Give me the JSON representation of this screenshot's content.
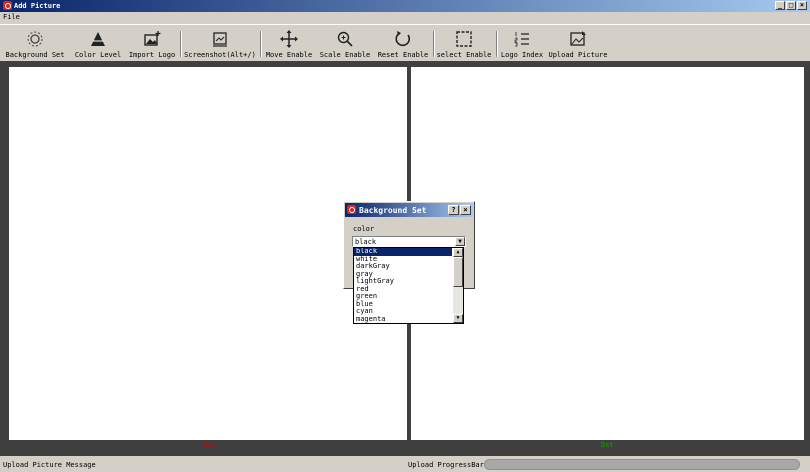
{
  "window": {
    "title": "Add Picture",
    "minimize": "_",
    "maximize": "□",
    "close": "×"
  },
  "menu": {
    "file": "File"
  },
  "toolbar": {
    "background_set": "Background Set",
    "color_level": "Color Level",
    "import_logo": "Import Logo",
    "screenshot": "Screenshot(Alt+/)",
    "move_enable": "Move Enable",
    "scale_enable": "Scale Enable",
    "reset_enable": "Reset Enable",
    "select_enable": "select Enable",
    "logo_index": "Logo Index",
    "upload_picture": "Upload Picture"
  },
  "panels": {
    "left_tag": "Src",
    "right_tag": "Dst",
    "left_tag_color": "#cc0000",
    "right_tag_color": "#00aa00"
  },
  "status": {
    "message": "Upload Picture Message",
    "progress_label": "Upload ProgressBar:",
    "progress_value": 0.0
  },
  "dialog": {
    "title": "Background Set",
    "help": "?",
    "close": "×",
    "field_label": "color",
    "selected": "black",
    "options": [
      "black",
      "white",
      "darkGray",
      "gray",
      "lightGray",
      "red",
      "green",
      "blue",
      "cyan",
      "magenta"
    ]
  }
}
